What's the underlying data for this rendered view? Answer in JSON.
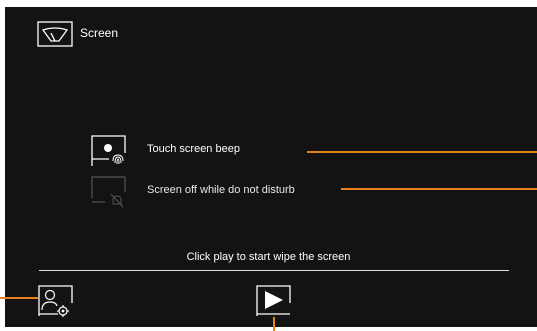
{
  "header": {
    "title": "Screen",
    "icon": "wiper-icon"
  },
  "options": [
    {
      "label": "Touch screen beep",
      "icon": "fingerprint-touch-icon",
      "enabled": true
    },
    {
      "label": "Screen off while do not disturb",
      "icon": "bell-off-icon",
      "enabled": false
    }
  ],
  "hint": "Click play to start wipe the screen",
  "bottom_bar": {
    "left_icon": "user-settings-icon",
    "play_icon": "play-icon"
  },
  "colors": {
    "background": "#131313",
    "text": "#ffffff",
    "callout": "#e8801e",
    "disabled_icon": "#555555"
  }
}
